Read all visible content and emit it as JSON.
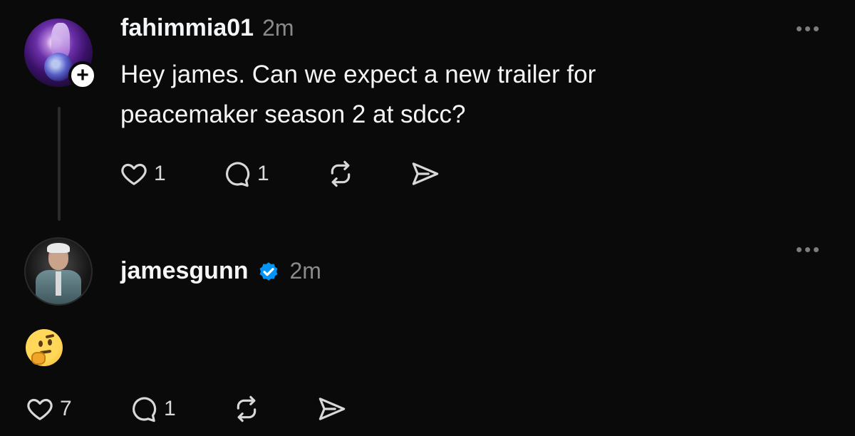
{
  "post": {
    "username": "fahimmia01",
    "time": "2m",
    "text": "Hey james. Can we expect a new trailer for peacemaker season 2 at sdcc?",
    "follow_glyph": "+",
    "likes": "1",
    "replies": "1",
    "icons": [
      "heart-icon",
      "comment-icon",
      "repost-icon",
      "share-icon",
      "more-icon",
      "plus-icon"
    ]
  },
  "reply": {
    "username": "jamesgunn",
    "verified_color": "#0095f6",
    "time": "2m",
    "emoji": "thinking-face",
    "likes": "7",
    "replies": "1",
    "icons": [
      "heart-icon",
      "comment-icon",
      "repost-icon",
      "share-icon",
      "more-icon",
      "verified-badge-icon"
    ]
  },
  "colors": {
    "background": "#0a0a0a",
    "text": "#f3f5f7",
    "muted": "#8a8a8a",
    "verified": "#0095f6"
  }
}
